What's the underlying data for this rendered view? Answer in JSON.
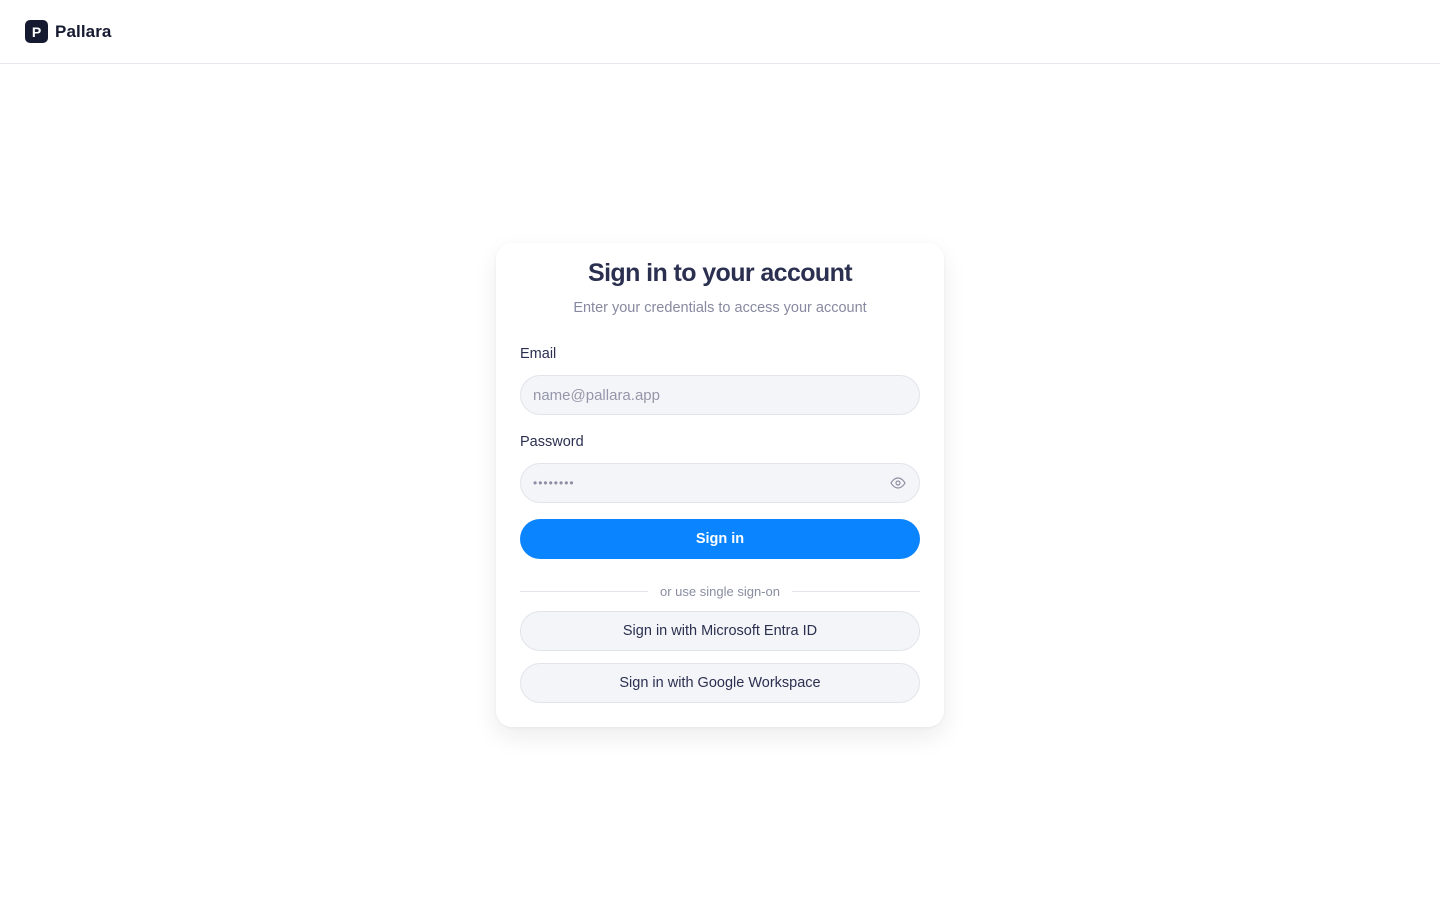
{
  "header": {
    "logo_letter": "P",
    "brand_name": "Pallara"
  },
  "signin": {
    "title": "Sign in to your account",
    "subtitle": "Enter your credentials to access your account",
    "email": {
      "label": "Email",
      "placeholder": "name@pallara.app",
      "value": ""
    },
    "password": {
      "label": "Password",
      "masked_value": "••••••••",
      "toggle_icon": "eye-icon"
    },
    "submit_label": "Sign in",
    "divider_text": "or use single sign-on",
    "sso": {
      "microsoft_label": "Sign in with Microsoft Entra ID",
      "google_label": "Sign in with Google Workspace"
    }
  },
  "colors": {
    "accent": "#0a84ff",
    "brand_dark": "#151a30",
    "input_bg": "#f4f5f8"
  }
}
